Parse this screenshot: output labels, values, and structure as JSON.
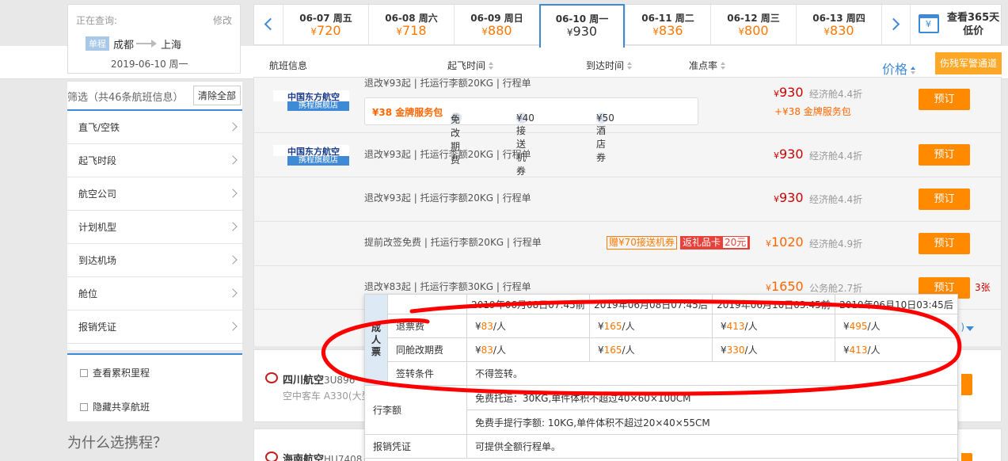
{
  "query": {
    "label": "正在查询:",
    "modify": "修改",
    "trip_type": "单程",
    "from": "成都",
    "to": "上海",
    "date": "2019-06-10 周一"
  },
  "filters": {
    "title": "筛选（共46条航班信息）",
    "clear": "清除全部",
    "items": [
      "直飞/空铁",
      "起飞时段",
      "航空公司",
      "计划机型",
      "到达机场",
      "舱位",
      "报销凭证"
    ],
    "checks": [
      "查看累积里程",
      "隐藏共享航班"
    ],
    "why": "为什么选携程？"
  },
  "dates": [
    {
      "date": "06-07 周五",
      "price": "720"
    },
    {
      "date": "06-08 周六",
      "price": "718"
    },
    {
      "date": "06-09 周日",
      "price": "880"
    },
    {
      "date": "06-10 周一",
      "price": "930"
    },
    {
      "date": "06-11 周二",
      "price": "836"
    },
    {
      "date": "06-12 周三",
      "price": "800"
    },
    {
      "date": "06-13 周四",
      "price": "830"
    }
  ],
  "currency": "¥",
  "calendar": {
    "line1": "查看365天",
    "line2": "低价"
  },
  "columns": {
    "flight": "航班信息",
    "depart": "起飞时间",
    "arrive": "到达时间",
    "ontime": "准点率",
    "price": "价格",
    "alert": "伤残军警通道"
  },
  "airline_logo": {
    "name": "中国东方航空",
    "store": "携程旗舰店"
  },
  "rows": [
    {
      "rules": "退改¥93起 | 托运行李额20KG | 行程单",
      "price": "930",
      "cabin": "经济舱4.4折",
      "book": "预订",
      "extra": "+¥38 金牌服务包"
    },
    {
      "rules": "退改¥93起 | 托运行李额20KG | 行程单",
      "price": "930",
      "cabin": "经济舱4.4折",
      "book": "预订"
    },
    {
      "rules": "退改¥93起 | 托运行李额20KG | 行程单",
      "price": "930",
      "cabin": "经济舱4.4折",
      "book": "预订"
    },
    {
      "rules": "提前改签免费 | 托运行李额20KG | 行程单",
      "price": "1020",
      "cabin": "经济舱4.9折",
      "book": "预订",
      "tag1": "赠¥70接送机券",
      "tag2": "返礼品卡",
      "tag2_amount": "20元"
    },
    {
      "rules": "退改¥83起 | 托运行李额30KG | 行程单",
      "price": "1650",
      "cabin": "公务舱2.7折",
      "book": "预订",
      "tickets": "3张"
    }
  ],
  "service_box": {
    "gold": "¥38 金牌服务包",
    "free_change": "免改期费",
    "transfer": "¥40接送机券",
    "hotel": "¥50酒店券",
    "change_icon": "改"
  },
  "more_paren": ")",
  "flight2": {
    "airline": "四川航空",
    "flight_no": "3U896",
    "aircraft": "空中客车 A330(大型"
  },
  "flight3": {
    "airline": "海南航空",
    "flight_no": "HU7408"
  },
  "popup": {
    "headers": [
      "2019年06月08日07:45前",
      "2019年06月08日07:45后",
      "2019年06月10日03:45前",
      "2019年06月10日03:45后"
    ],
    "section": "成人票",
    "refund_label": "退票费",
    "refund": [
      "83",
      "165",
      "413",
      "495"
    ],
    "change_label": "同舱改期费",
    "change": [
      "83",
      "165",
      "330",
      "413"
    ],
    "per": "/人",
    "endorse_label": "签转条件",
    "endorse": "不得签转。",
    "baggage_label": "行李额",
    "baggage_checked": "免费托运：30KG,单件体积不超过40×60×100CM",
    "baggage_hand": "免费手提行李额: 10KG,单件体积不超过20×40×55CM",
    "receipt_label": "报销凭证",
    "receipt": "可提供全额行程单。"
  },
  "colors": {
    "accent": "#3e8ad6",
    "orange": "#ff8a00",
    "price_red": "#cc0000",
    "annotation": "#ff0000"
  }
}
